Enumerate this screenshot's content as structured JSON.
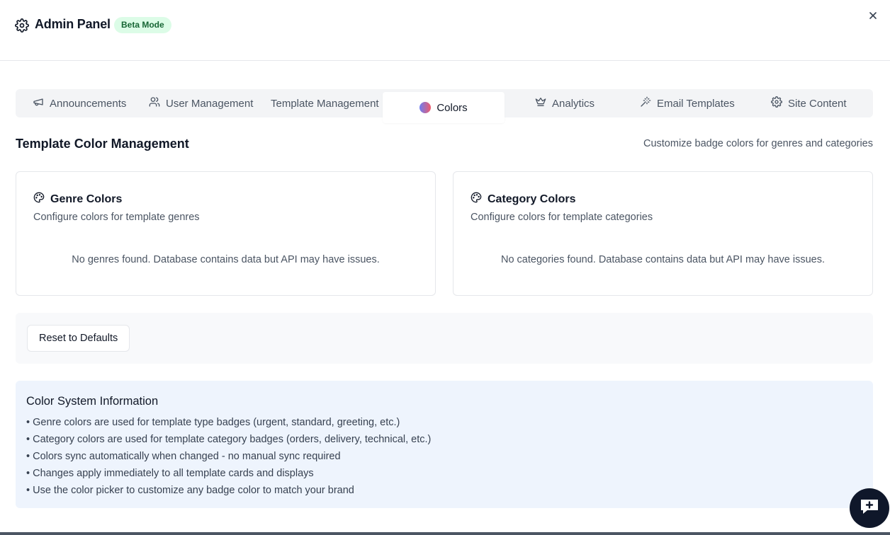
{
  "header": {
    "title": "Admin Panel",
    "badge": "Beta Mode"
  },
  "tabs": [
    {
      "label": "Announcements",
      "icon": "megaphone-icon"
    },
    {
      "label": "User Management",
      "icon": "users-icon"
    },
    {
      "label": "Template Management",
      "icon": ""
    },
    {
      "label": "Colors",
      "icon": "color-dot-icon",
      "active": true
    },
    {
      "label": "Analytics",
      "icon": "crown-icon"
    },
    {
      "label": "Email Templates",
      "icon": "wand-icon"
    },
    {
      "label": "Site Content",
      "icon": "gear-icon"
    }
  ],
  "section": {
    "title": "Template Color Management",
    "subtitle": "Customize badge colors for genres and categories"
  },
  "genre_card": {
    "title": "Genre Colors",
    "description": "Configure colors for template genres",
    "empty": "No genres found. Database contains data but API may have issues."
  },
  "category_card": {
    "title": "Category Colors",
    "description": "Configure colors for template categories",
    "empty": "No categories found. Database contains data but API may have issues."
  },
  "actions": {
    "reset_label": "Reset to Defaults"
  },
  "info": {
    "title": "Color System Information",
    "items": [
      "• Genre colors are used for template type badges (urgent, standard, greeting, etc.)",
      "• Category colors are used for template category badges (orders, delivery, technical, etc.)",
      "• Colors sync automatically when changed - no manual sync required",
      "• Changes apply immediately to all template cards and displays",
      "• Use the color picker to customize any badge color to match your brand"
    ]
  },
  "colors": {
    "badge_bg": "#dcfce7",
    "badge_text": "#166534",
    "info_bg": "#eef4fd",
    "chat_button": "#0f172a"
  }
}
